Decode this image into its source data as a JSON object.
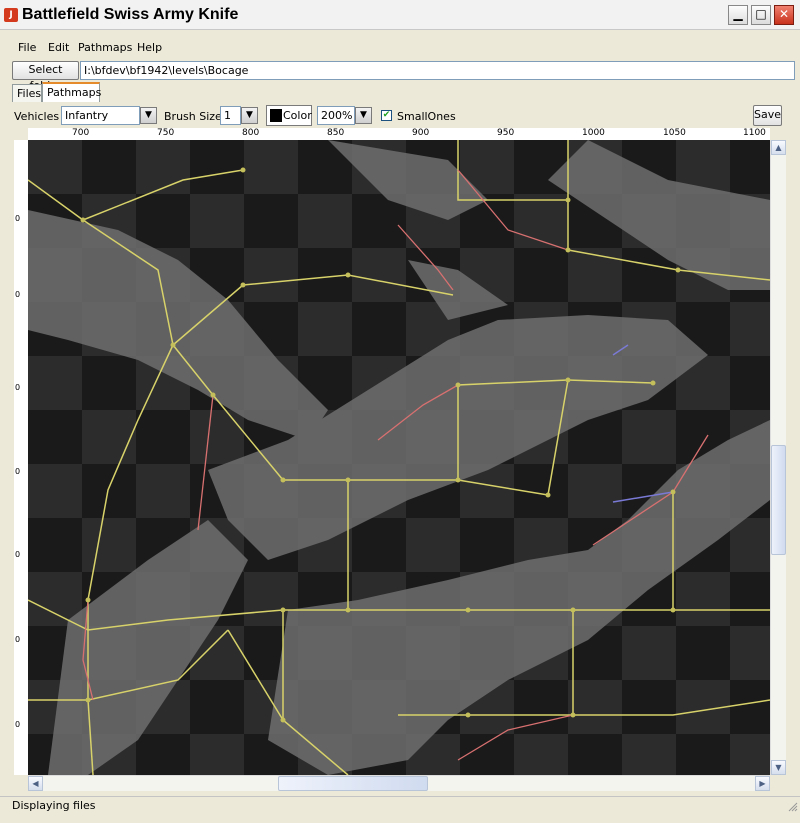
{
  "window": {
    "title": "Battlefield Swiss Army Knife",
    "icon": "app-logo-icon"
  },
  "menu": [
    "File",
    "Edit",
    "Pathmaps",
    "Help"
  ],
  "folder": {
    "button_label": "Select folder",
    "path": "I:\\bfdev\\bf1942\\levels\\Bocage"
  },
  "tabs": [
    {
      "label": "Files",
      "active": false
    },
    {
      "label": "Pathmaps",
      "active": true
    }
  ],
  "toolbar": {
    "vehicles_label": "Vehicles",
    "vehicles_value": "Infantry",
    "brush_label": "Brush Size",
    "brush_value": "1",
    "color_label": "Color",
    "color_value": "#000000",
    "zoom_value": "200%",
    "small_ones_label": "SmallOnes",
    "small_ones_checked": true,
    "save_label": "Save"
  },
  "ruler": {
    "h_ticks": [
      "700",
      "750",
      "800",
      "850",
      "900",
      "950",
      "1000",
      "1050",
      "1100"
    ],
    "v_ticks": [
      "0",
      "0",
      "0",
      "0",
      "0",
      "0",
      "0",
      "0",
      "0"
    ]
  },
  "status": {
    "text": "Displaying files"
  },
  "colors": {
    "path_line": "#d8d26a",
    "path_node": "#c4bf5a",
    "red_line": "#d87070",
    "blue_line": "#7a7ad6"
  }
}
